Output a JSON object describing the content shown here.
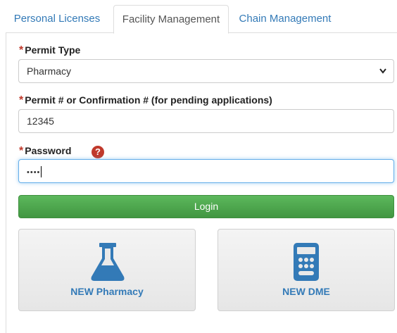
{
  "tabs": [
    {
      "label": "Personal Licenses"
    },
    {
      "label": "Facility Management"
    },
    {
      "label": "Chain Management"
    }
  ],
  "form": {
    "permit_type": {
      "label": "Permit Type",
      "required_mark": "*",
      "value": "Pharmacy"
    },
    "permit_number": {
      "label": "Permit # or Confirmation # (for pending applications)",
      "required_mark": "*",
      "value": "12345"
    },
    "password": {
      "label": "Password",
      "required_mark": "*",
      "value": "••••",
      "help_mark": "?"
    }
  },
  "login_label": "Login",
  "cards": [
    {
      "label": "NEW Pharmacy",
      "icon": "flask-icon"
    },
    {
      "label": "NEW DME",
      "icon": "calculator-icon"
    }
  ],
  "colors": {
    "link": "#337ab7",
    "required": "#c0392b",
    "login_green": "#5cb85c"
  }
}
